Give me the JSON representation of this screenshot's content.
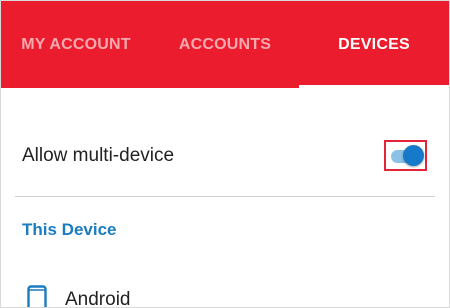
{
  "tabs": {
    "my_account": "MY ACCOUNT",
    "accounts": "ACCOUNTS",
    "devices": "DEVICES",
    "active": "devices"
  },
  "settings": {
    "allow_multi_device_label": "Allow multi-device",
    "allow_multi_device_enabled": true
  },
  "this_device": {
    "section_title": "This Device",
    "device_icon": "smartphone-icon",
    "device_name": "Android"
  },
  "colors": {
    "tabbar_background": "#ea1c2d",
    "accent_blue": "#1b7cc0",
    "toggle_thumb": "#1779c9",
    "toggle_track": "#8bc2e6",
    "highlight_frame": "#e32439"
  }
}
